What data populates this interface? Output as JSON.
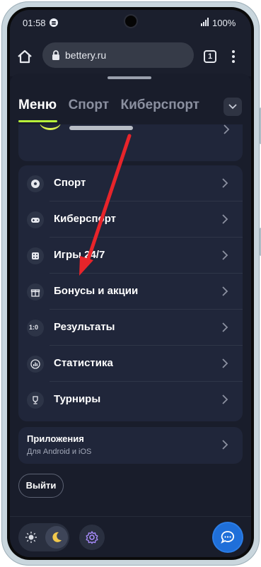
{
  "status_bar": {
    "time": "01:58",
    "battery": "100%"
  },
  "browser": {
    "url": "bettery.ru",
    "tab_count": "1"
  },
  "top_tabs": [
    {
      "label": "Меню",
      "active": true
    },
    {
      "label": "Спорт",
      "active": false
    },
    {
      "label": "Киберспорт",
      "active": false
    }
  ],
  "menu_items": [
    {
      "label": "Спорт",
      "icon": "soccer-ball-icon"
    },
    {
      "label": "Киберспорт",
      "icon": "gamepad-icon"
    },
    {
      "label": "Игры 24/7",
      "icon": "dice-icon"
    },
    {
      "label": "Бонусы и акции",
      "icon": "gift-icon"
    },
    {
      "label": "Результаты",
      "icon": "score-icon"
    },
    {
      "label": "Статистика",
      "icon": "stats-icon"
    },
    {
      "label": "Турниры",
      "icon": "trophy-icon"
    }
  ],
  "apps": {
    "title": "Приложения",
    "subtitle": "Для Android и iOS"
  },
  "logout_label": "Выйти",
  "score_icon_text": "1:0",
  "colors": {
    "accent": "#b8f13a",
    "background": "#191d2b",
    "card": "#20263a",
    "chat": "#1f6fd9",
    "arrow": "#e8242a"
  }
}
